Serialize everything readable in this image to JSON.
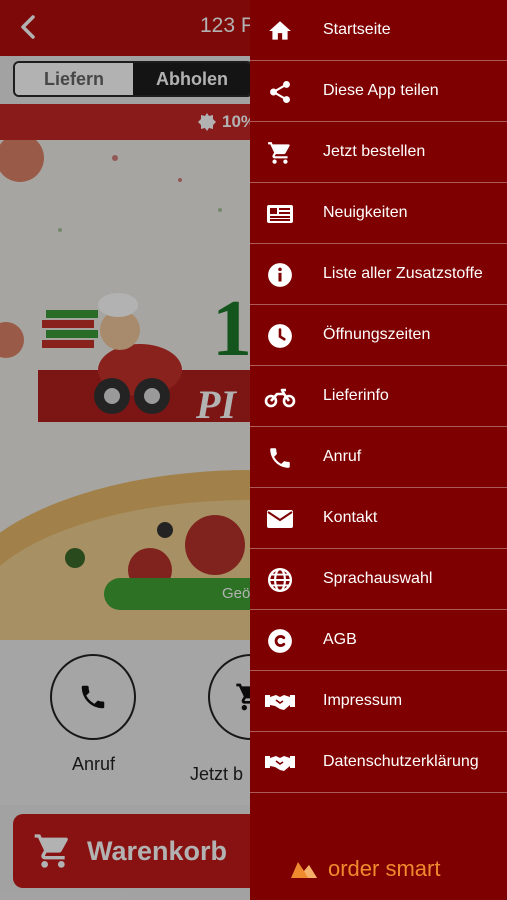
{
  "header": {
    "title": "123 P",
    "back_icon": "chevron-left-icon"
  },
  "order_mode": {
    "options": [
      "Liefern",
      "Abholen"
    ],
    "selected": "Abholen"
  },
  "promo": {
    "text": "10%"
  },
  "hero": {
    "logo_text_1": "1",
    "logo_text_2": "PI",
    "button_label": "Geö"
  },
  "actions": [
    {
      "label": "Anruf",
      "icon": "phone-icon"
    },
    {
      "label": "Jetzt b",
      "icon": "cart-icon"
    }
  ],
  "cart": {
    "label": "Warenkorb",
    "icon": "cart-icon"
  },
  "menu": {
    "items": [
      {
        "label": "Startseite",
        "icon": "home-icon"
      },
      {
        "label": "Diese App teilen",
        "icon": "share-icon"
      },
      {
        "label": "Jetzt bestellen",
        "icon": "cart-icon"
      },
      {
        "label": "Neuigkeiten",
        "icon": "newspaper-icon"
      },
      {
        "label": "Liste aller Zusatzstoffe",
        "icon": "info-icon"
      },
      {
        "label": "Öffnungszeiten",
        "icon": "clock-icon"
      },
      {
        "label": "Lieferinfo",
        "icon": "motorcycle-icon"
      },
      {
        "label": "Anruf",
        "icon": "phone-icon"
      },
      {
        "label": "Kontakt",
        "icon": "envelope-icon"
      },
      {
        "label": "Sprachauswahl",
        "icon": "globe-icon"
      },
      {
        "label": "AGB",
        "icon": "copyright-icon"
      },
      {
        "label": "Impressum",
        "icon": "handshake-icon"
      },
      {
        "label": "Datenschutzerklärung",
        "icon": "handshake-icon"
      }
    ],
    "brand": "order smart"
  },
  "colors": {
    "header_red": "#b40d0d",
    "drawer_red": "#7f0000",
    "accent_green": "#3fa334",
    "brand_orange": "#f08a2f"
  }
}
